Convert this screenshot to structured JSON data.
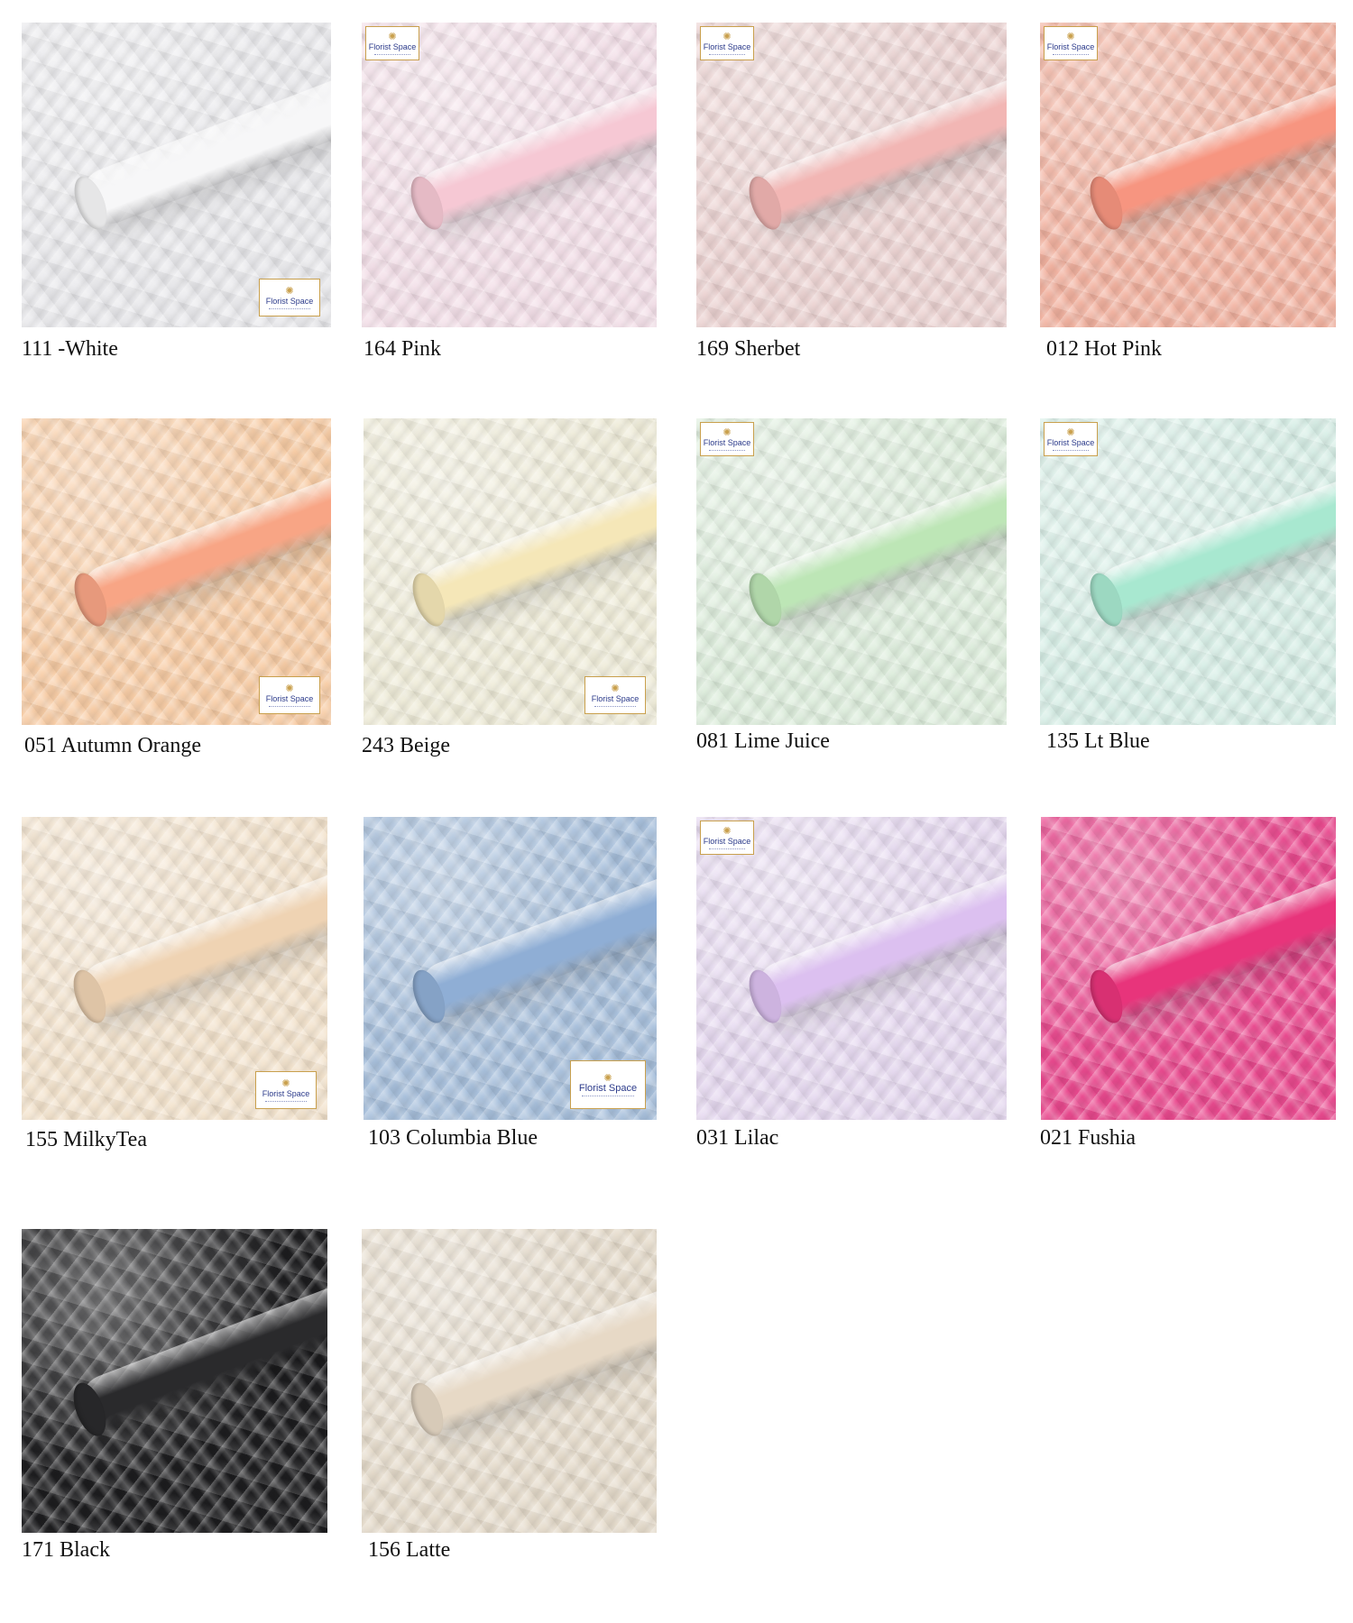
{
  "brand": {
    "logo_text": "Florist Space"
  },
  "swatches": [
    {
      "code_name": "111 -White",
      "base": "#e9e9ec",
      "roll": "#f7f7f8",
      "logo": "br"
    },
    {
      "code_name": "164 Pink",
      "base": "#f3dfe8",
      "roll": "#f6c8d4",
      "logo": "tl"
    },
    {
      "code_name": "169 Sherbet",
      "base": "#ecd3d2",
      "roll": "#f2b6b4",
      "logo": "tl"
    },
    {
      "code_name": "012 Hot Pink",
      "base": "#f2b2a0",
      "roll": "#f79580",
      "logo": "tl"
    },
    {
      "code_name": "051 Autumn Orange",
      "base": "#f8cda6",
      "roll": "#f8a585",
      "logo": "br"
    },
    {
      "code_name": "243 Beige",
      "base": "#efecd9",
      "roll": "#f5e7b8",
      "logo": "br"
    },
    {
      "code_name": "081 Lime Juice",
      "base": "#deeedd",
      "roll": "#bde6b6",
      "logo": "tl"
    },
    {
      "code_name": "135 Lt Blue",
      "base": "#d8efe7",
      "roll": "#a8e8d0",
      "logo": "tl"
    },
    {
      "code_name": "155 MilkyTea",
      "base": "#f3e3cd",
      "roll": "#efd3b3",
      "logo": "br"
    },
    {
      "code_name": "103 Columbia Blue",
      "base": "#a8c0dc",
      "roll": "#8faed5",
      "logo": "br"
    },
    {
      "code_name": "031 Lilac",
      "base": "#e6d9f0",
      "roll": "#dcc0f0",
      "logo": "tl"
    },
    {
      "code_name": "021 Fushia",
      "base": "#ea4a8f",
      "roll": "#e8347b",
      "logo": "none"
    },
    {
      "code_name": "171 Black",
      "base": "#1d1d1f",
      "roll": "#2a2a2c",
      "logo": "none"
    },
    {
      "code_name": "156 Latte",
      "base": "#e6dccc",
      "roll": "#e7d9c6",
      "logo": "none"
    }
  ]
}
